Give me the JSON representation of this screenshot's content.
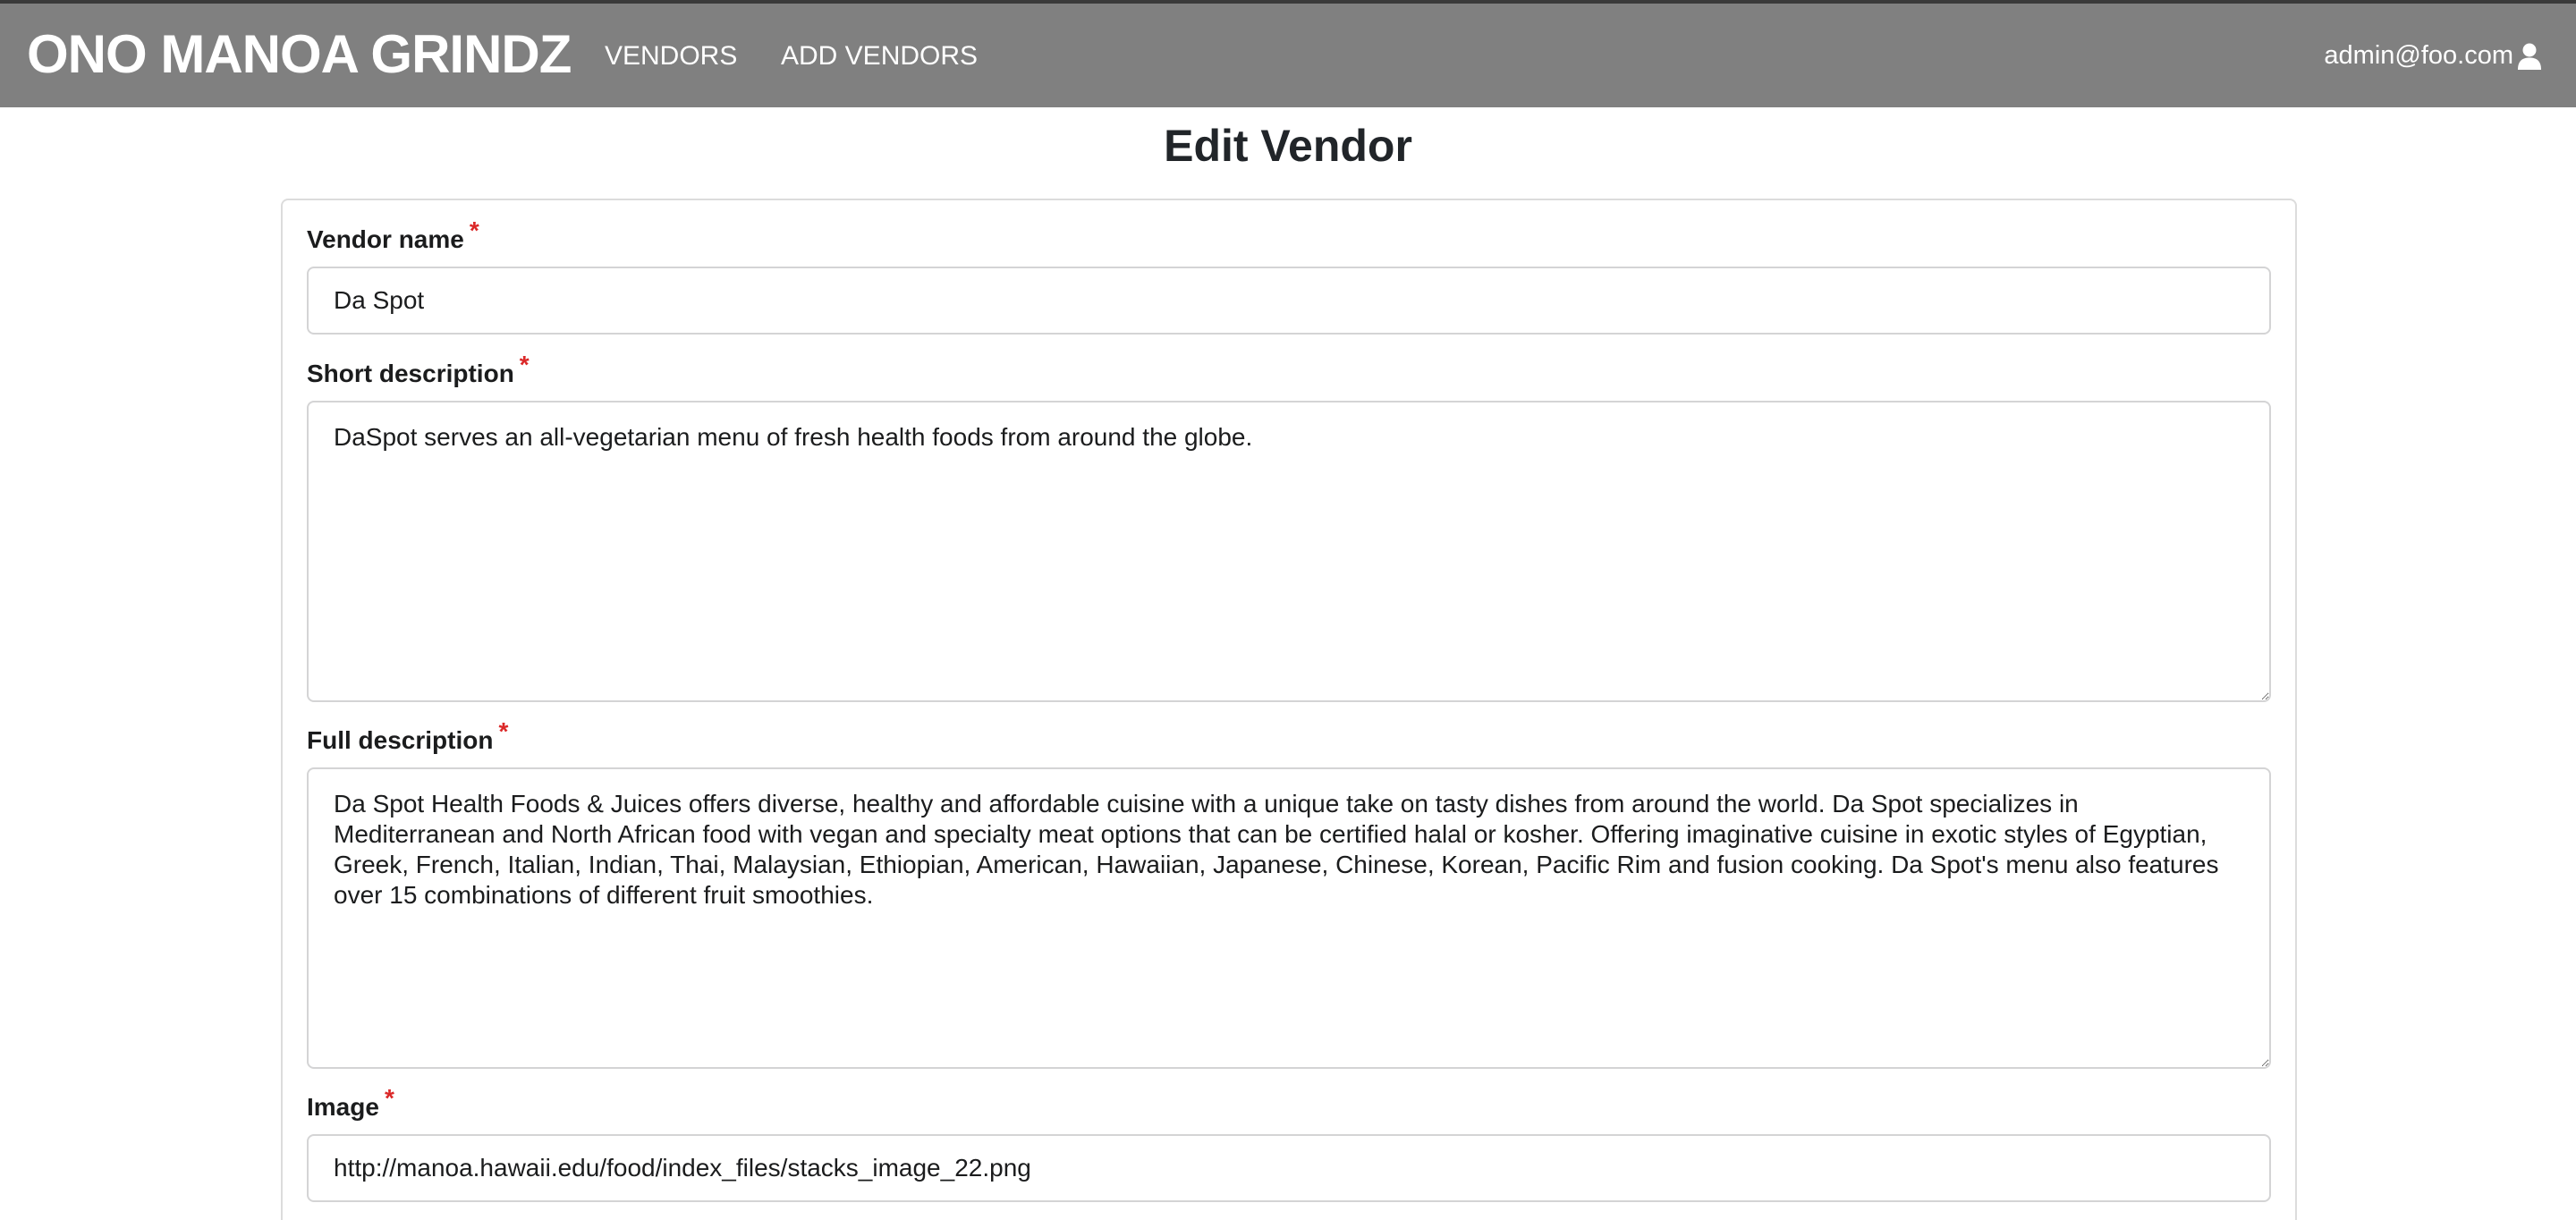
{
  "navbar": {
    "brand": "ONO MANOA GRINDZ",
    "links": [
      {
        "label": "VENDORS"
      },
      {
        "label": "ADD VENDORS"
      }
    ],
    "user": {
      "email": "admin@foo.com",
      "icon": "user-icon"
    }
  },
  "page": {
    "title": "Edit Vendor"
  },
  "form": {
    "required_marker": "*",
    "vendor_name": {
      "label": "Vendor name",
      "value": "Da Spot"
    },
    "short_description": {
      "label": "Short description",
      "value": "DaSpot serves an all-vegetarian menu of fresh health foods from around the globe."
    },
    "full_description": {
      "label": "Full description",
      "value": "Da Spot Health Foods & Juices offers diverse, healthy and affordable cuisine with a unique take on tasty dishes from around the world. Da Spot specializes in Mediterranean and North African food with vegan and specialty meat options that can be certified halal or kosher. Offering imaginative cuisine in exotic styles of Egyptian, Greek, French, Italian, Indian, Thai, Malaysian, Ethiopian, American, Hawaiian, Japanese, Chinese, Korean, Pacific Rim and fusion cooking. Da Spot's menu also features over 15 combinations of different fruit smoothies."
    },
    "image": {
      "label": "Image",
      "value": "http://manoa.hawaii.edu/food/index_files/stacks_image_22.png"
    }
  },
  "colors": {
    "navbar_bg": "#808080",
    "required": "#db2828"
  }
}
